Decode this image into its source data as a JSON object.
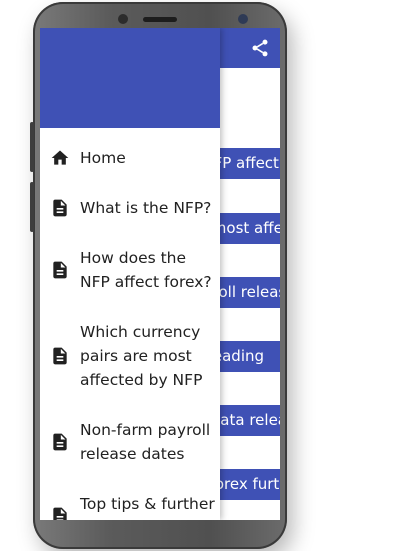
{
  "drawer": {
    "items": [
      {
        "label": "Home",
        "icon": "home-icon"
      },
      {
        "label": "What is the NFP?",
        "icon": "document-icon"
      },
      {
        "label": "How does the NFP affect forex?",
        "icon": "document-icon"
      },
      {
        "label": "Which currency pairs are most affected by NFP",
        "icon": "document-icon"
      },
      {
        "label": "Non-farm payroll release dates",
        "icon": "document-icon"
      },
      {
        "label": "Top tips & further",
        "icon": "document-icon"
      }
    ]
  },
  "page": {
    "buttons": [
      "How does the NFP affect forex?",
      "Which currency pairs are most affected",
      "Non-farm payroll release dates",
      "Further reading",
      "Non-farm payroll data release",
      "How to trade the NFP in forex further"
    ]
  },
  "colors": {
    "primary": "#3f51b5",
    "icon": "#212121",
    "text": "#212121"
  }
}
